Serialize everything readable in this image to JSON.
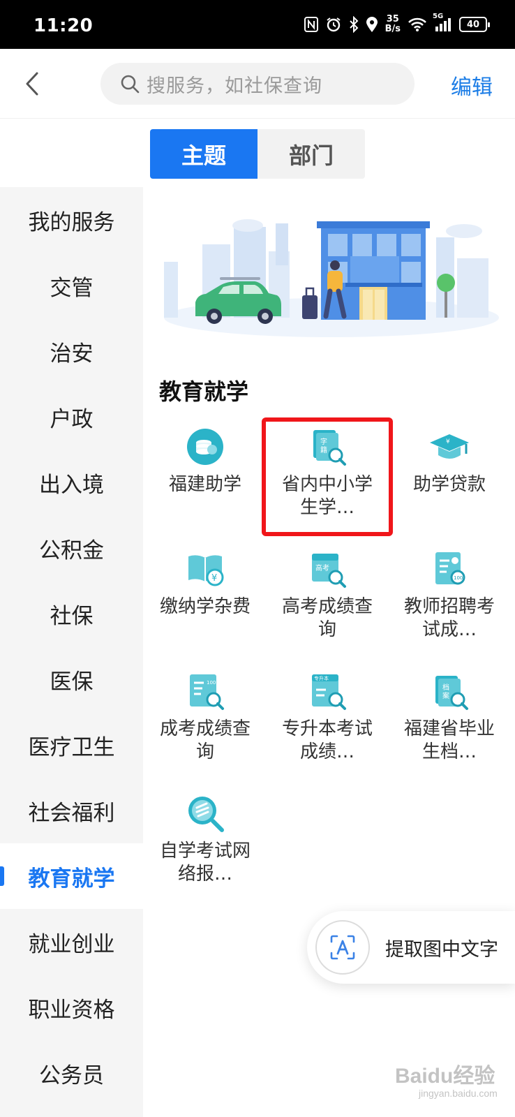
{
  "status_bar": {
    "time": "11:20",
    "net_speed_value": "35",
    "net_speed_unit": "B/s",
    "network_type": "5G",
    "battery": "40",
    "icons": [
      "nfc-icon",
      "alarm-icon",
      "bluetooth-icon",
      "location-icon",
      "wifi-icon",
      "signal-icon",
      "battery-icon"
    ]
  },
  "header": {
    "search_placeholder": "搜服务，如社保查询",
    "edit_label": "编辑"
  },
  "tabs": [
    {
      "label": "主题",
      "active": true
    },
    {
      "label": "部门",
      "active": false
    }
  ],
  "sidebar": {
    "items": [
      {
        "label": "我的服务"
      },
      {
        "label": "交管"
      },
      {
        "label": "治安"
      },
      {
        "label": "户政"
      },
      {
        "label": "出入境"
      },
      {
        "label": "公积金"
      },
      {
        "label": "社保"
      },
      {
        "label": "医保"
      },
      {
        "label": "医疗卫生"
      },
      {
        "label": "社会福利"
      },
      {
        "label": "教育就学",
        "active": true
      },
      {
        "label": "就业创业"
      },
      {
        "label": "职业资格"
      },
      {
        "label": "公务员"
      }
    ]
  },
  "section": {
    "title": "教育就学",
    "services": [
      {
        "label": "福建助学",
        "icon": "scholarship-coins-icon"
      },
      {
        "label": "省内中小学生学…",
        "icon": "student-record-search-icon",
        "highlighted": true
      },
      {
        "label": "助学贷款",
        "icon": "graduation-cap-icon"
      },
      {
        "label": "缴纳学杂费",
        "icon": "book-yuan-icon"
      },
      {
        "label": "高考成绩查询",
        "icon": "gaokao-search-icon"
      },
      {
        "label": "教师招聘考试成…",
        "icon": "teacher-exam-score-icon"
      },
      {
        "label": "成考成绩查询",
        "icon": "adult-exam-score-icon"
      },
      {
        "label": "专升本考试成绩…",
        "icon": "upgrade-exam-score-icon"
      },
      {
        "label": "福建省毕业生档…",
        "icon": "graduate-archive-search-icon"
      },
      {
        "label": "自学考试网络报…",
        "icon": "self-study-exam-icon"
      }
    ]
  },
  "floating_button": {
    "label": "提取图中文字",
    "icon": "text-extract-icon"
  },
  "watermark": {
    "text": "Baidu经验",
    "sub": "jingyan.baidu.com"
  },
  "colors": {
    "accent": "#1a77f2",
    "highlight": "#f0161a",
    "icon_teal": "#2bb3c8"
  }
}
